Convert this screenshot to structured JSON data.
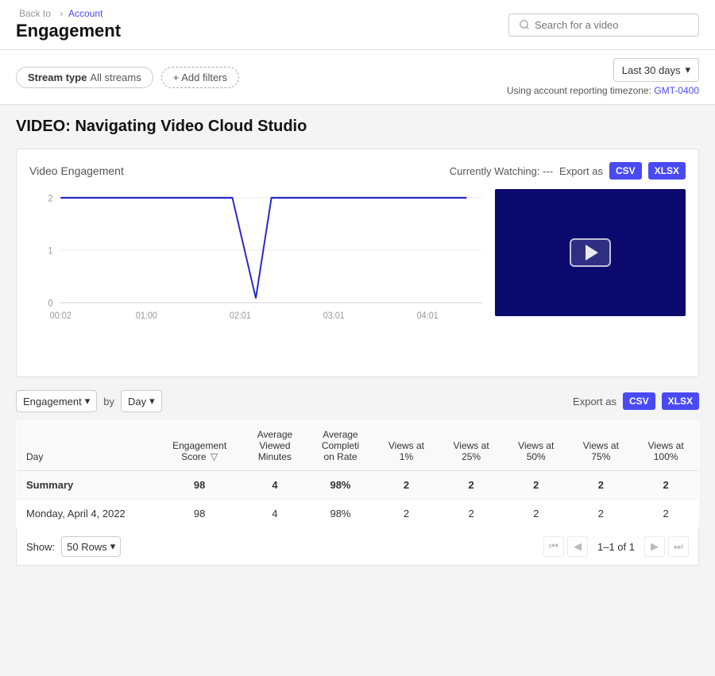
{
  "breadcrumb": {
    "back_text": "Back to",
    "separator": "›",
    "account_text": "Account"
  },
  "header": {
    "title": "Engagement",
    "search_placeholder": "Search for a video"
  },
  "filters": {
    "stream_type_label": "Stream type",
    "stream_type_value": "All streams",
    "add_filters_label": "+ Add filters",
    "date_range_label": "Last 30 days",
    "timezone_prefix": "Using account reporting timezone:",
    "timezone_link": "GMT-0400"
  },
  "video": {
    "title": "VIDEO: Navigating Video Cloud Studio"
  },
  "chart": {
    "title": "Video Engagement",
    "watching_label": "Currently Watching: ---",
    "export_label": "Export as",
    "csv_label": "CSV",
    "xlsx_label": "XLSX",
    "x_axis": [
      "00:02",
      "01:00",
      "02:01",
      "03:01",
      "04:01"
    ],
    "y_axis": [
      "2",
      "1",
      "0"
    ]
  },
  "table_controls": {
    "metric_label": "Engagement",
    "by_label": "by",
    "period_label": "Day",
    "export_label": "Export as",
    "csv_label": "CSV",
    "xlsx_label": "XLSX"
  },
  "table": {
    "columns": [
      "Day",
      "Engagement Score ▽",
      "Average Viewed Minutes",
      "Average Completion Rate",
      "Views at 1%",
      "Views at 25%",
      "Views at 50%",
      "Views at 75%",
      "Views at 100%"
    ],
    "summary_row": {
      "label": "Summary",
      "engagement_score": "98",
      "avg_viewed_min": "4",
      "avg_completion": "98%",
      "views_1": "2",
      "views_25": "2",
      "views_50": "2",
      "views_75": "2",
      "views_100": "2"
    },
    "rows": [
      {
        "day": "Monday, April 4, 2022",
        "engagement_score": "98",
        "avg_viewed_min": "4",
        "avg_completion": "98%",
        "views_1": "2",
        "views_25": "2",
        "views_50": "2",
        "views_75": "2",
        "views_100": "2"
      }
    ]
  },
  "pagination": {
    "show_label": "Show:",
    "rows_per_page": "50 Rows",
    "page_info": "1–1 of 1"
  }
}
